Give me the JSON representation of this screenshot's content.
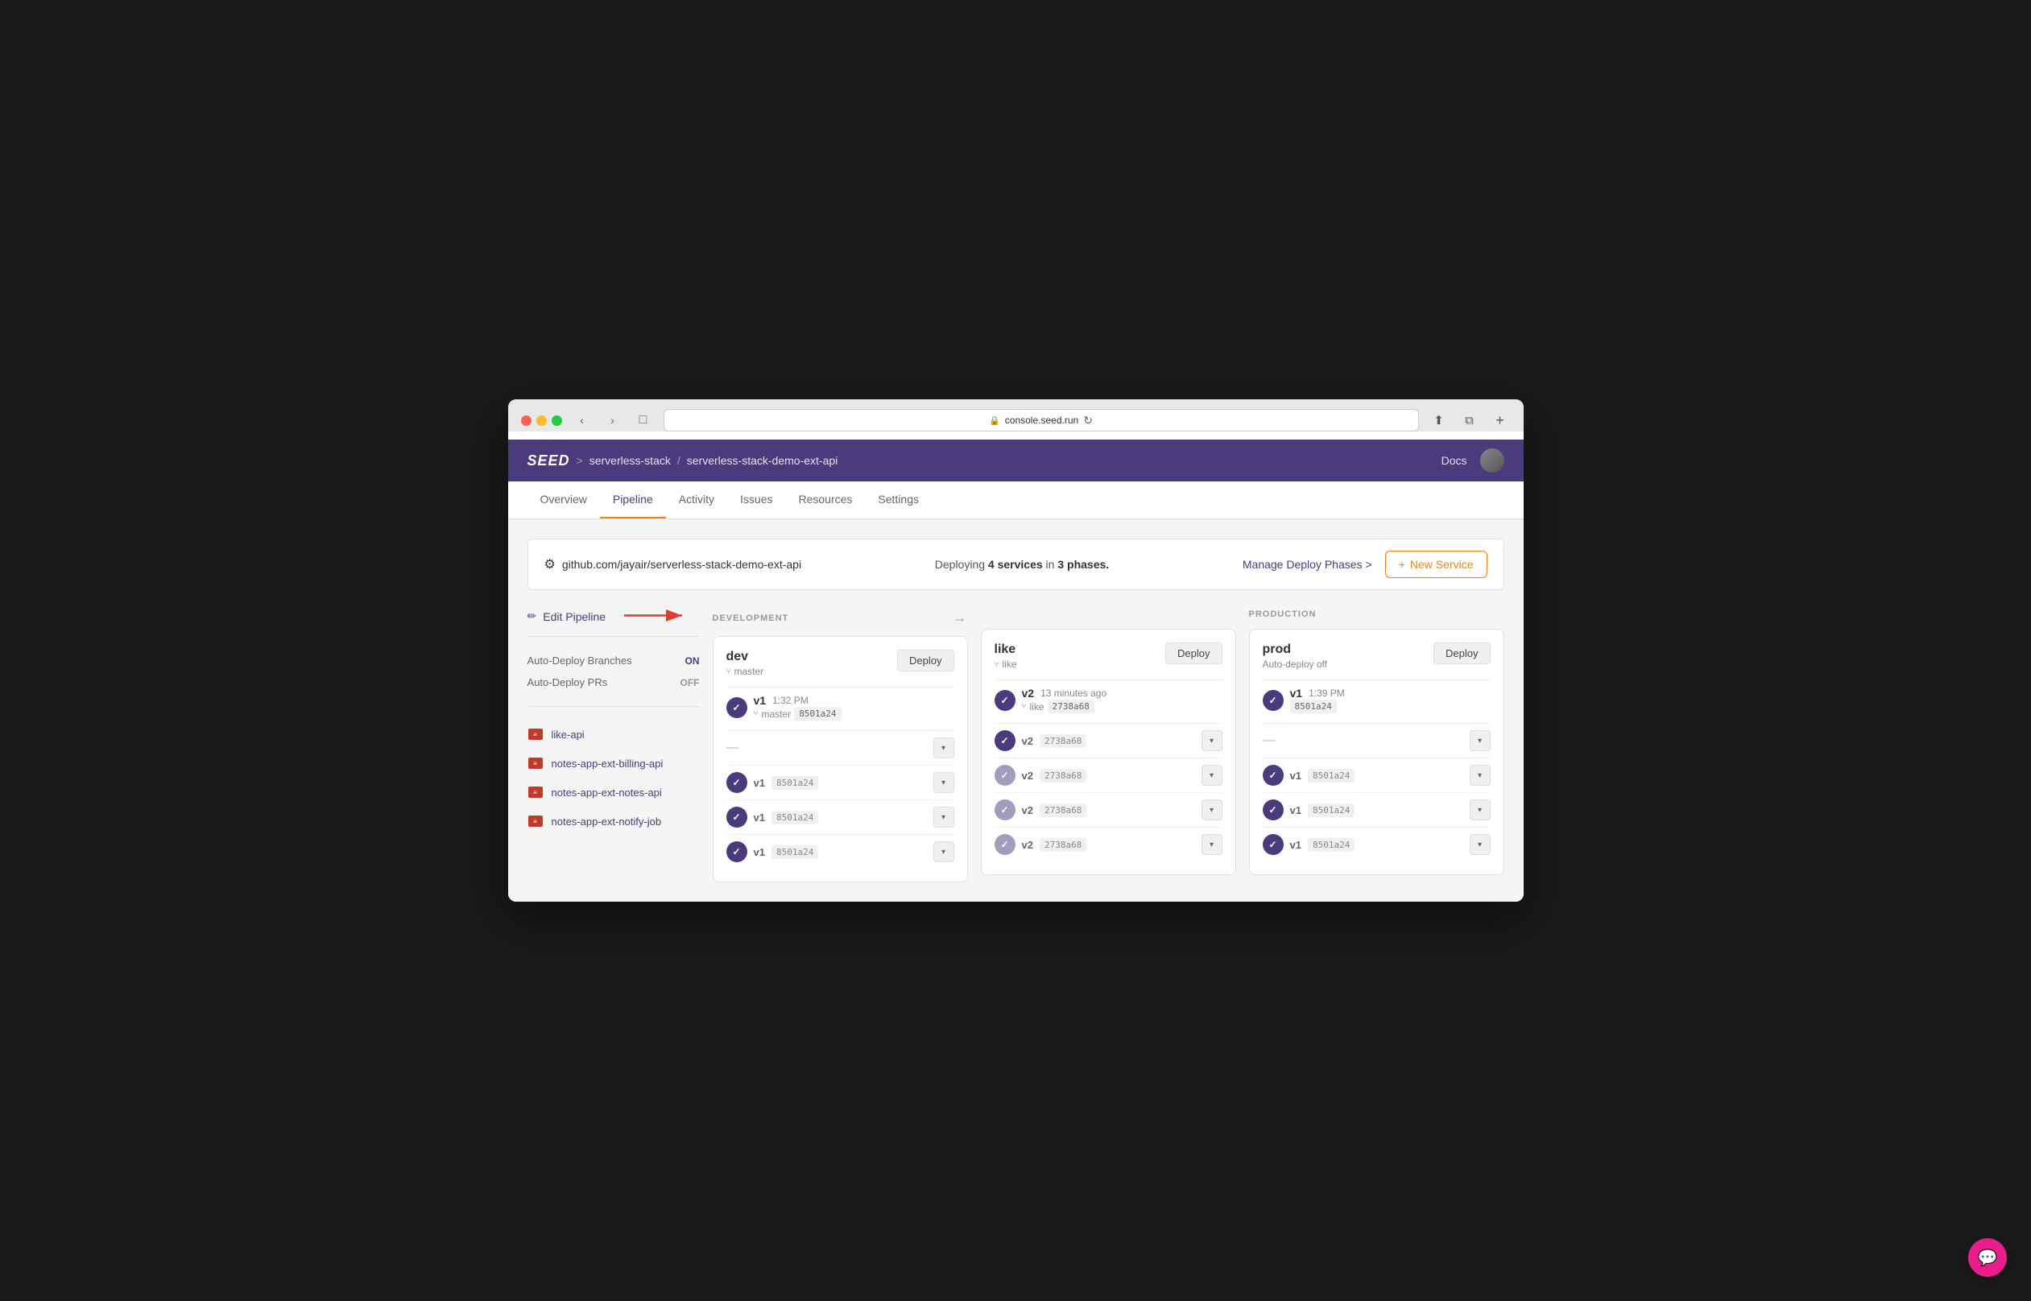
{
  "browser": {
    "url": "console.seed.run",
    "back_btn": "‹",
    "forward_btn": "›",
    "tab_btn": "⬜",
    "refresh_icon": "↻",
    "share_icon": "⬆",
    "new_window_icon": "⧉",
    "plus_icon": "+"
  },
  "header": {
    "logo": "SEED",
    "breadcrumb_sep": ">",
    "breadcrumb_1": "serverless-stack",
    "breadcrumb_slash": "/",
    "breadcrumb_2": "serverless-stack-demo-ext-api",
    "docs": "Docs"
  },
  "nav": {
    "tabs": [
      {
        "label": "Overview",
        "active": false
      },
      {
        "label": "Pipeline",
        "active": true
      },
      {
        "label": "Activity",
        "active": false
      },
      {
        "label": "Issues",
        "active": false
      },
      {
        "label": "Resources",
        "active": false
      },
      {
        "label": "Settings",
        "active": false
      }
    ]
  },
  "topbar": {
    "github_url": "github.com/jayair/serverless-stack-demo-ext-api",
    "deploy_info": "Deploying",
    "services_count": "4 services",
    "phases_text": "in",
    "phases_count": "3 phases.",
    "manage_link": "Manage Deploy Phases",
    "manage_arrow": ">",
    "new_service_plus": "+",
    "new_service_label": "New Service"
  },
  "sidebar": {
    "edit_pipeline": "Edit Pipeline",
    "auto_deploy_branches_label": "Auto-Deploy Branches",
    "auto_deploy_branches_value": "ON",
    "auto_deploy_prs_label": "Auto-Deploy PRs",
    "auto_deploy_prs_value": "OFF",
    "services": [
      {
        "name": "like-api"
      },
      {
        "name": "notes-app-ext-billing-api"
      },
      {
        "name": "notes-app-ext-notes-api"
      },
      {
        "name": "notes-app-ext-notify-job"
      }
    ]
  },
  "pipeline": {
    "dev_section_label": "DEVELOPMENT",
    "prod_section_label": "PRODUCTION",
    "arrow": "→",
    "stages": [
      {
        "id": "dev",
        "name": "dev",
        "branch": "master",
        "deploy_btn": "Deploy",
        "deploy_version": "v1",
        "deploy_time": "1:32 PM",
        "deploy_branch": "master",
        "deploy_commit": "8501a24",
        "services": [
          {
            "has_check": false,
            "version": "",
            "commit": "",
            "dash": "—"
          },
          {
            "has_check": true,
            "version": "v1",
            "commit": "8501a24"
          },
          {
            "has_check": true,
            "version": "v1",
            "commit": "8501a24"
          },
          {
            "has_check": true,
            "version": "v1",
            "commit": "8501a24"
          }
        ]
      },
      {
        "id": "like",
        "name": "like",
        "branch": "like",
        "deploy_btn": "Deploy",
        "deploy_version": "v2",
        "deploy_time": "13 minutes ago",
        "deploy_branch": "like",
        "deploy_commit": "2738a68",
        "services": [
          {
            "has_check": true,
            "version": "v2",
            "commit": "2738a68"
          },
          {
            "has_check": true,
            "faded": true,
            "version": "v2",
            "commit": "2738a68"
          },
          {
            "has_check": true,
            "faded": true,
            "version": "v2",
            "commit": "2738a68"
          },
          {
            "has_check": true,
            "faded": true,
            "version": "v2",
            "commit": "2738a68"
          }
        ]
      },
      {
        "id": "prod",
        "name": "prod",
        "branch": "",
        "sub_label": "Auto-deploy off",
        "deploy_btn": "Deploy",
        "deploy_version": "v1",
        "deploy_time": "1:39 PM",
        "deploy_branch": "",
        "deploy_commit": "8501a24",
        "services": [
          {
            "has_check": false,
            "version": "",
            "commit": "",
            "dash": "—"
          },
          {
            "has_check": true,
            "version": "v1",
            "commit": "8501a24"
          },
          {
            "has_check": true,
            "version": "v1",
            "commit": "8501a24"
          },
          {
            "has_check": true,
            "version": "v1",
            "commit": "8501a24"
          }
        ]
      }
    ]
  },
  "chat": {
    "icon": "💬"
  }
}
